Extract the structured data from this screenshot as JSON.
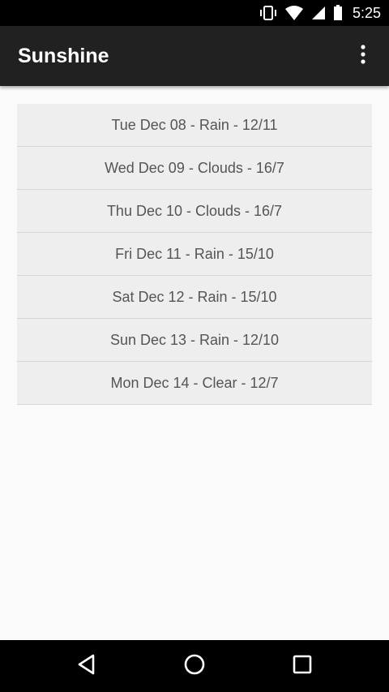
{
  "status_bar": {
    "time": "5:25",
    "icons": [
      "vibrate-icon",
      "wifi-icon",
      "cell-signal-icon",
      "battery-icon"
    ]
  },
  "app_bar": {
    "title": "Sunshine",
    "menu_icon": "overflow-menu-icon"
  },
  "forecast": {
    "items": [
      "Tue Dec 08 - Rain - 12/11",
      "Wed Dec 09 - Clouds - 16/7",
      "Thu Dec 10 - Clouds - 16/7",
      "Fri Dec 11 - Rain - 15/10",
      "Sat Dec 12 - Rain - 15/10",
      "Sun Dec 13 - Rain - 12/10",
      "Mon Dec 14 - Clear - 12/7"
    ]
  },
  "nav_bar": {
    "icons": [
      "back-icon",
      "home-icon",
      "recents-icon"
    ]
  },
  "colors": {
    "status_bar": "#000000",
    "app_bar": "#212121",
    "background": "#fafafa",
    "list_item": "#eeeeee",
    "list_text": "#555555"
  }
}
